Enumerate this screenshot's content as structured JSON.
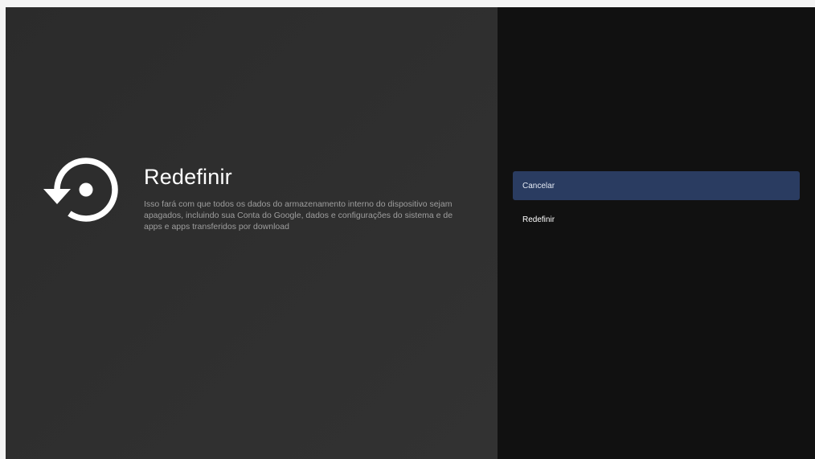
{
  "dialog": {
    "icon": "restore-icon",
    "title": "Redefinir",
    "description": "Isso fará com que todos os dados do armazenamento interno do dispositivo sejam apagados, incluindo sua Conta do Google, dados e configurações do sistema e de apps e apps transferidos por download"
  },
  "actions": {
    "cancel_label": "Cancelar",
    "reset_label": "Redefinir",
    "selected": "Cancelar"
  },
  "colors": {
    "selected_background": "#2a3c61",
    "left_panel": "#2e2e2e",
    "right_panel": "#111111"
  }
}
